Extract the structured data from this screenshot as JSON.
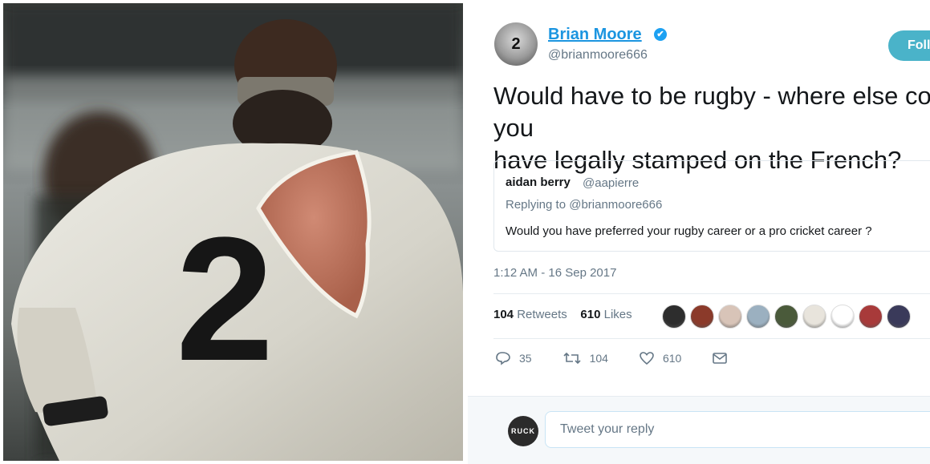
{
  "photo": {
    "jersey_number": "2"
  },
  "tweet": {
    "avatar_number": "2",
    "display_name": "Brian Moore",
    "verified_icon": "✔",
    "handle": "@brianmoore666",
    "follow_label": "Follow",
    "text": "Would have to be rugby - where else could you\nhave legally stamped on the French?",
    "quote": {
      "name": "aidan berry",
      "handle": "@aapierre",
      "replying_to": "Replying to @brianmoore666",
      "text": "Would you have preferred your rugby career or a pro cricket career ?"
    },
    "timestamp": "1:12 AM - 16 Sep 2017",
    "retweets_count": "104",
    "retweets_label": "Retweets",
    "likes_count": "610",
    "likes_label": "Likes",
    "liker_avatar_colors": [
      "#2d2d2d",
      "#8b3a2a",
      "#d8c4b8",
      "#9bb0c0",
      "#4a5a3a",
      "#e8e4dc",
      "#ffffff",
      "#a83a3a",
      "#3a3a5a"
    ],
    "actions": {
      "replies": "35",
      "retweets": "104",
      "likes": "610"
    },
    "reply_avatar_text": "RUCK",
    "reply_placeholder": "Tweet your reply"
  },
  "colors": {
    "accent": "#1da1f2",
    "follow": "#4ab3c9",
    "muted": "#657786"
  }
}
